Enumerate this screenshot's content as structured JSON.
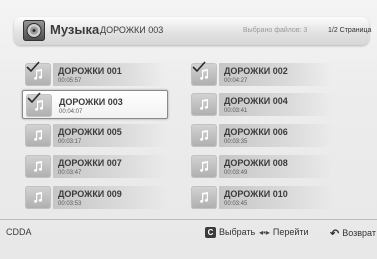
{
  "header": {
    "title": "Музыка",
    "subtitle": "ДОРОЖКИ 003",
    "selected_files": "Выбрано файлов: 3",
    "page": "1/2 Страница"
  },
  "tracks": [
    {
      "name": "ДОРОЖКИ 001",
      "duration": "00:05:57",
      "checked": true
    },
    {
      "name": "ДОРОЖКИ 002",
      "duration": "00:04:27",
      "checked": true
    },
    {
      "name": "ДОРОЖКИ 003",
      "duration": "00:04:07",
      "checked": true,
      "selected": true
    },
    {
      "name": "ДОРОЖКИ 004",
      "duration": "00:03:41",
      "checked": false
    },
    {
      "name": "ДОРОЖКИ 005",
      "duration": "00:03:17",
      "checked": false
    },
    {
      "name": "ДОРОЖКИ 006",
      "duration": "00:03:35",
      "checked": false
    },
    {
      "name": "ДОРОЖКИ 007",
      "duration": "00:03:47",
      "checked": false
    },
    {
      "name": "ДОРОЖКИ 008",
      "duration": "00:03:49",
      "checked": false
    },
    {
      "name": "ДОРОЖКИ 009",
      "duration": "00:03:53",
      "checked": false
    },
    {
      "name": "ДОРОЖКИ 010",
      "duration": "00:03:45",
      "checked": false
    }
  ],
  "footer": {
    "source": "CDDA",
    "select_key": "C",
    "select_label": "Выбрать",
    "move_glyph": "◂▪▸",
    "move_label": "Перейти",
    "back_glyph": "↶",
    "back_label": "Возврат"
  },
  "icons": {
    "app": "music-disc-icon",
    "thumb": "music-note-icon",
    "check": "checkmark-icon"
  },
  "colors": {
    "background": "#ececec",
    "text": "#3c3c3c",
    "muted": "#9a9a9a"
  }
}
